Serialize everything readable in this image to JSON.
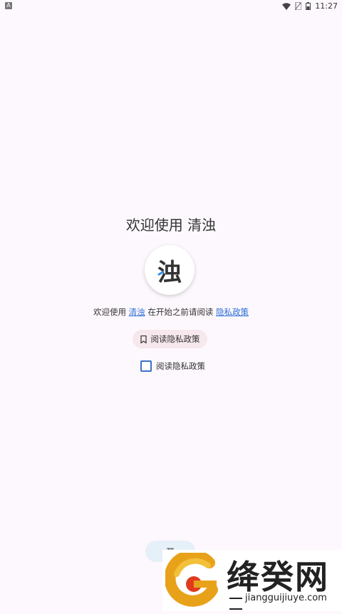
{
  "status_bar": {
    "left_icon": "A",
    "time": "11:27",
    "icons": [
      "wifi-icon",
      "sim-icon",
      "battery-icon"
    ]
  },
  "welcome": {
    "title": "欢迎使用 清浊",
    "logo_char": "浊",
    "intro_prefix": "欢迎使用 ",
    "app_link": "清浊",
    "intro_middle": " 在开始之前请阅读 ",
    "policy_link": "隐私政策"
  },
  "actions": {
    "read_policy_button": "阅读隐私政策",
    "read_policy_checkbox": "阅读隐私政策",
    "bottom_button": "开"
  },
  "watermark": {
    "title": "绛癸网",
    "domain": "jiangguijiuye.com"
  },
  "colors": {
    "background": "#fdf8fd",
    "link": "#2f6fd6",
    "checkbox": "#3d72c9",
    "button_pink": "#f6e8ec",
    "button_blue": "#e5f0f8"
  }
}
